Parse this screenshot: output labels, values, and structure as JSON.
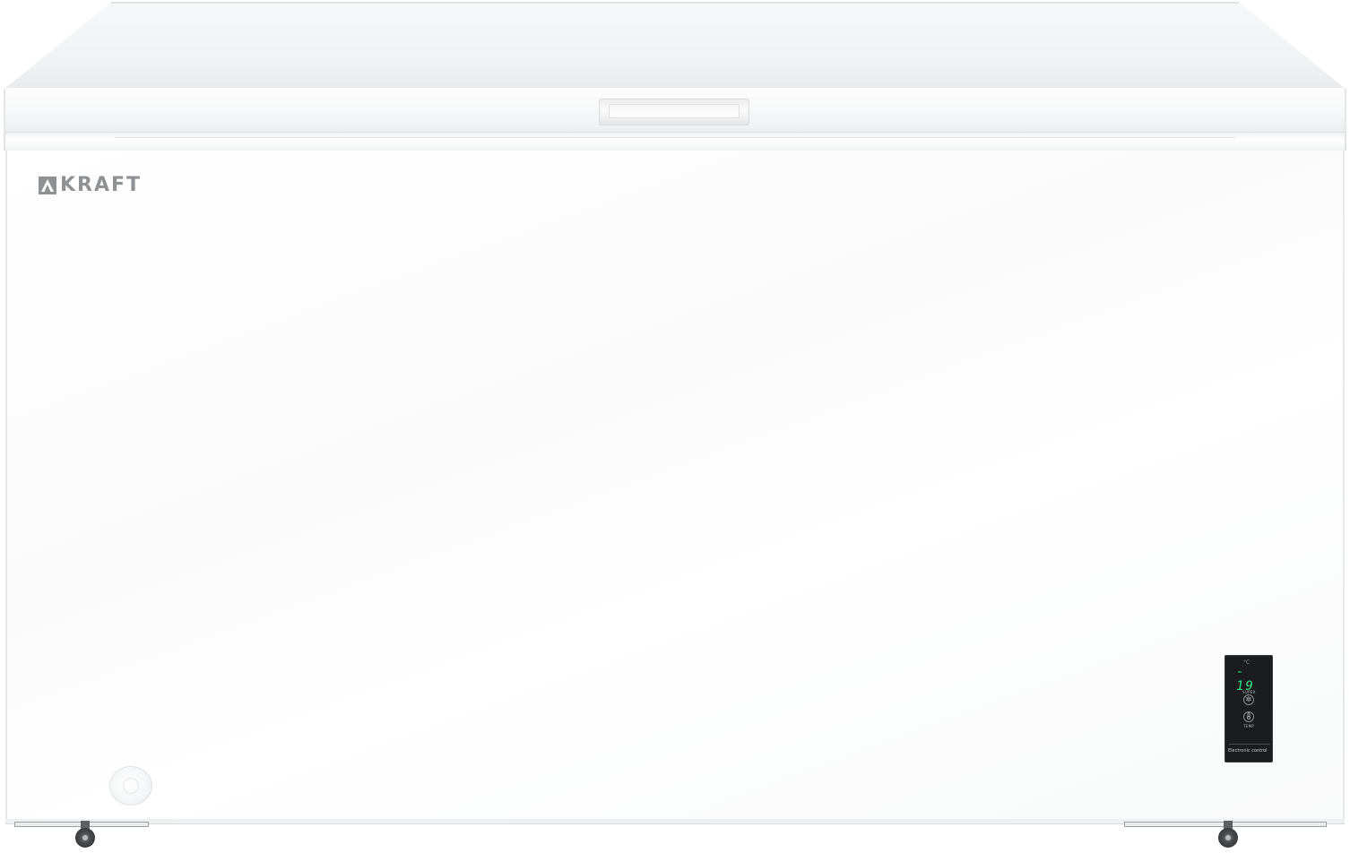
{
  "product": {
    "brand": "KRAFT",
    "control_panel": {
      "unit": "°C",
      "temperature_display": "- 19",
      "super_label": "SUPER",
      "temp_label": "TEMP",
      "caption": "Electronic control",
      "display_color": "#2ee08a"
    },
    "colors": {
      "body": "#ffffff",
      "logo": "#8f9194",
      "panel": "#1b1c1e"
    },
    "icons": [
      "snowflake-icon",
      "thermometer-icon"
    ]
  }
}
